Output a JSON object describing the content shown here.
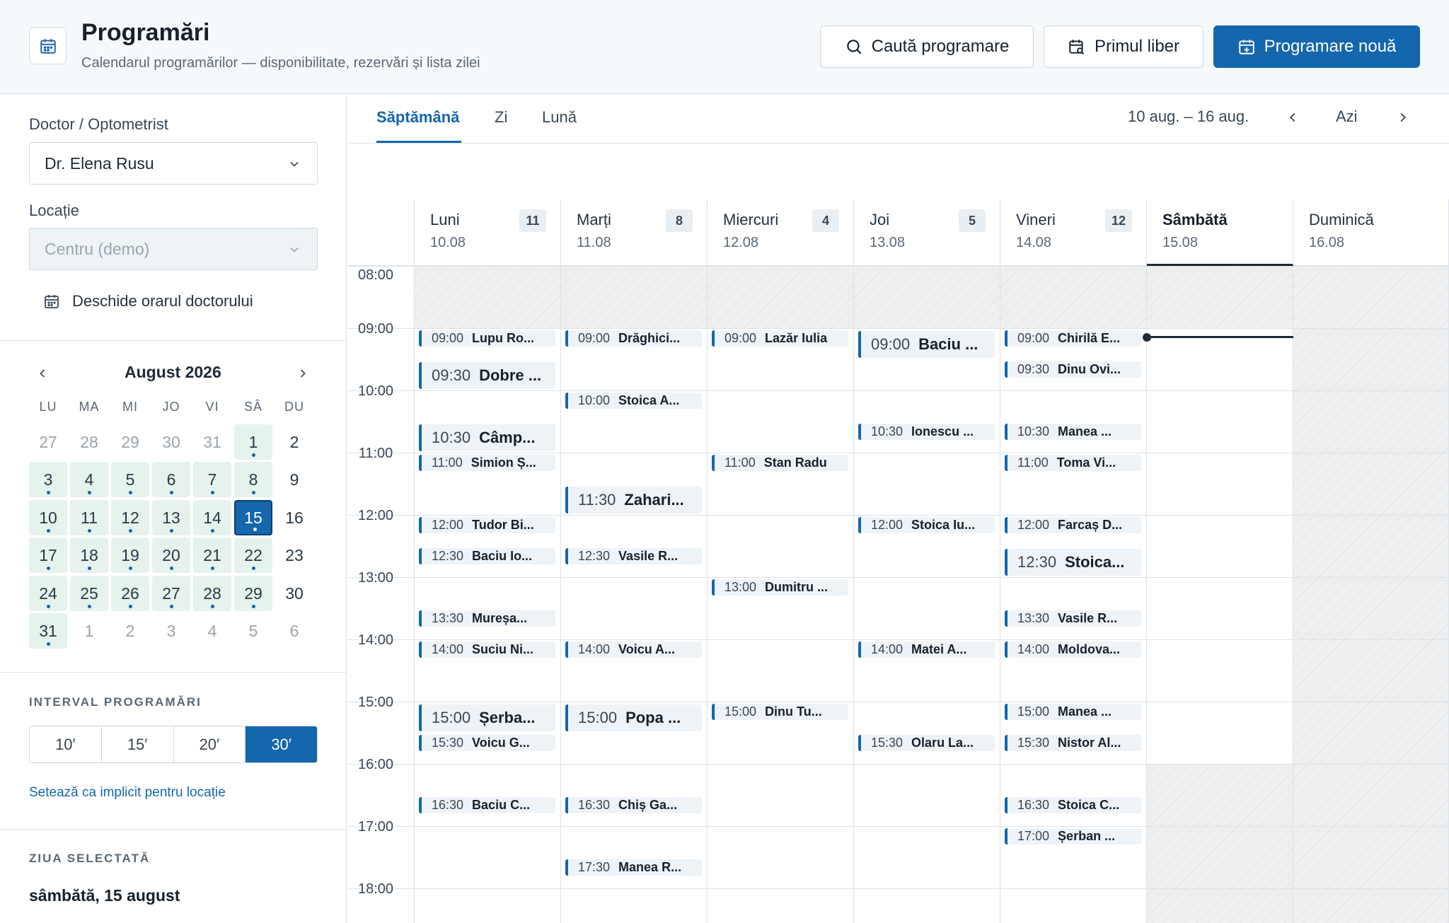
{
  "header": {
    "title": "Programări",
    "subtitle": "Calendarul programărilor — disponibilitate, rezervări și lista zilei",
    "search_label": "Caută programare",
    "first_free_label": "Primul liber",
    "new_label": "Programare nouă"
  },
  "sidebar": {
    "doctor_label": "Doctor / Optometrist",
    "doctor_value": "Dr. Elena Rusu",
    "location_label": "Locație",
    "location_value": "Centru (demo)",
    "open_schedule": "Deschide orarul doctorului",
    "month_title": "August 2026",
    "weekdays": [
      "LU",
      "MA",
      "MI",
      "JO",
      "VI",
      "SÂ",
      "DU"
    ],
    "days": [
      [
        "27",
        "28",
        "29",
        "30",
        "31",
        "1",
        "2"
      ],
      [
        "3",
        "4",
        "5",
        "6",
        "7",
        "8",
        "9"
      ],
      [
        "10",
        "11",
        "12",
        "13",
        "14",
        "15",
        "16"
      ],
      [
        "17",
        "18",
        "19",
        "20",
        "21",
        "22",
        "23"
      ],
      [
        "24",
        "25",
        "26",
        "27",
        "28",
        "29",
        "30"
      ],
      [
        "31",
        "1",
        "2",
        "3",
        "4",
        "5",
        "6"
      ]
    ],
    "interval_title": "INTERVAL PROGRAMĂRI",
    "intervals": [
      "10′",
      "15′",
      "20′",
      "30′"
    ],
    "selected_interval": "30′",
    "set_default": "Setează ca implicit pentru locație",
    "selected_day_title": "ZIUA SELECTATĂ",
    "selected_day": "sâmbătă, 15 august"
  },
  "tabs": [
    "Săptămână",
    "Zi",
    "Lună"
  ],
  "active_tab": "Săptămână",
  "range": "10 aug. – 16 aug.",
  "today_label": "Azi",
  "hours": [
    "08:00",
    "09:00",
    "10:00",
    "11:00",
    "12:00",
    "13:00",
    "14:00",
    "15:00",
    "16:00",
    "17:00",
    "18:00"
  ],
  "days": [
    {
      "name": "Luni",
      "date": "10.08",
      "count": "11"
    },
    {
      "name": "Marți",
      "date": "11.08",
      "count": "8"
    },
    {
      "name": "Miercuri",
      "date": "12.08",
      "count": "4"
    },
    {
      "name": "Joi",
      "date": "13.08",
      "count": "5"
    },
    {
      "name": "Vineri",
      "date": "14.08",
      "count": "12"
    },
    {
      "name": "Sâmbătă",
      "date": "15.08",
      "count": ""
    },
    {
      "name": "Duminică",
      "date": "16.08",
      "count": ""
    }
  ],
  "appointments": [
    {
      "day": 0,
      "time": "09:00",
      "name": "Lupu Ro..."
    },
    {
      "day": 0,
      "time": "09:30",
      "name": "Dobre ...",
      "big": true
    },
    {
      "day": 0,
      "time": "10:30",
      "name": "Câmp...",
      "big": true
    },
    {
      "day": 0,
      "time": "11:00",
      "name": "Simion Ș..."
    },
    {
      "day": 0,
      "time": "12:00",
      "name": "Tudor Bi..."
    },
    {
      "day": 0,
      "time": "12:30",
      "name": "Baciu Io..."
    },
    {
      "day": 0,
      "time": "13:30",
      "name": "Mureșa..."
    },
    {
      "day": 0,
      "time": "14:00",
      "name": "Suciu Ni..."
    },
    {
      "day": 0,
      "time": "15:00",
      "name": "Șerba...",
      "big": true
    },
    {
      "day": 0,
      "time": "15:30",
      "name": "Voicu G..."
    },
    {
      "day": 0,
      "time": "16:30",
      "name": "Baciu C..."
    },
    {
      "day": 1,
      "time": "09:00",
      "name": "Drăghici..."
    },
    {
      "day": 1,
      "time": "10:00",
      "name": "Stoica A..."
    },
    {
      "day": 1,
      "time": "11:30",
      "name": "Zahari...",
      "big": true
    },
    {
      "day": 1,
      "time": "12:30",
      "name": "Vasile R..."
    },
    {
      "day": 1,
      "time": "14:00",
      "name": "Voicu A..."
    },
    {
      "day": 1,
      "time": "15:00",
      "name": "Popa ...",
      "big": true
    },
    {
      "day": 1,
      "time": "16:30",
      "name": "Chiș Ga..."
    },
    {
      "day": 1,
      "time": "17:30",
      "name": "Manea R..."
    },
    {
      "day": 2,
      "time": "09:00",
      "name": "Lazăr Iulia"
    },
    {
      "day": 2,
      "time": "11:00",
      "name": "Stan Radu"
    },
    {
      "day": 2,
      "time": "13:00",
      "name": "Dumitru ..."
    },
    {
      "day": 2,
      "time": "15:00",
      "name": "Dinu Tu..."
    },
    {
      "day": 3,
      "time": "09:00",
      "name": "Baciu ...",
      "big": true
    },
    {
      "day": 3,
      "time": "10:30",
      "name": "Ionescu ..."
    },
    {
      "day": 3,
      "time": "12:00",
      "name": "Stoica Iu..."
    },
    {
      "day": 3,
      "time": "14:00",
      "name": "Matei A..."
    },
    {
      "day": 3,
      "time": "15:30",
      "name": "Olaru La..."
    },
    {
      "day": 4,
      "time": "09:00",
      "name": "Chirilă E..."
    },
    {
      "day": 4,
      "time": "09:30",
      "name": "Dinu Ovi..."
    },
    {
      "day": 4,
      "time": "10:30",
      "name": "Manea ..."
    },
    {
      "day": 4,
      "time": "11:00",
      "name": "Toma Vi..."
    },
    {
      "day": 4,
      "time": "12:00",
      "name": "Farcaș D..."
    },
    {
      "day": 4,
      "time": "12:30",
      "name": "Stoica...",
      "big": true
    },
    {
      "day": 4,
      "time": "13:30",
      "name": "Vasile R..."
    },
    {
      "day": 4,
      "time": "14:00",
      "name": "Moldova..."
    },
    {
      "day": 4,
      "time": "15:00",
      "name": "Manea ..."
    },
    {
      "day": 4,
      "time": "15:30",
      "name": "Nistor Al..."
    },
    {
      "day": 4,
      "time": "16:30",
      "name": "Stoica C..."
    },
    {
      "day": 4,
      "time": "17:00",
      "name": "Șerban ..."
    }
  ],
  "colors": {
    "accent": "#1466ad",
    "available": "#e6f2ec",
    "now_line": "#1f2a37"
  },
  "icons": {
    "header": "calendar-icon",
    "search": "search-icon",
    "first_free": "calendar-search-icon",
    "new": "calendar-plus-icon",
    "select": "chevron-down-icon",
    "schedule": "calendar-icon",
    "prev": "chevron-left-icon",
    "next": "chevron-right-icon"
  }
}
